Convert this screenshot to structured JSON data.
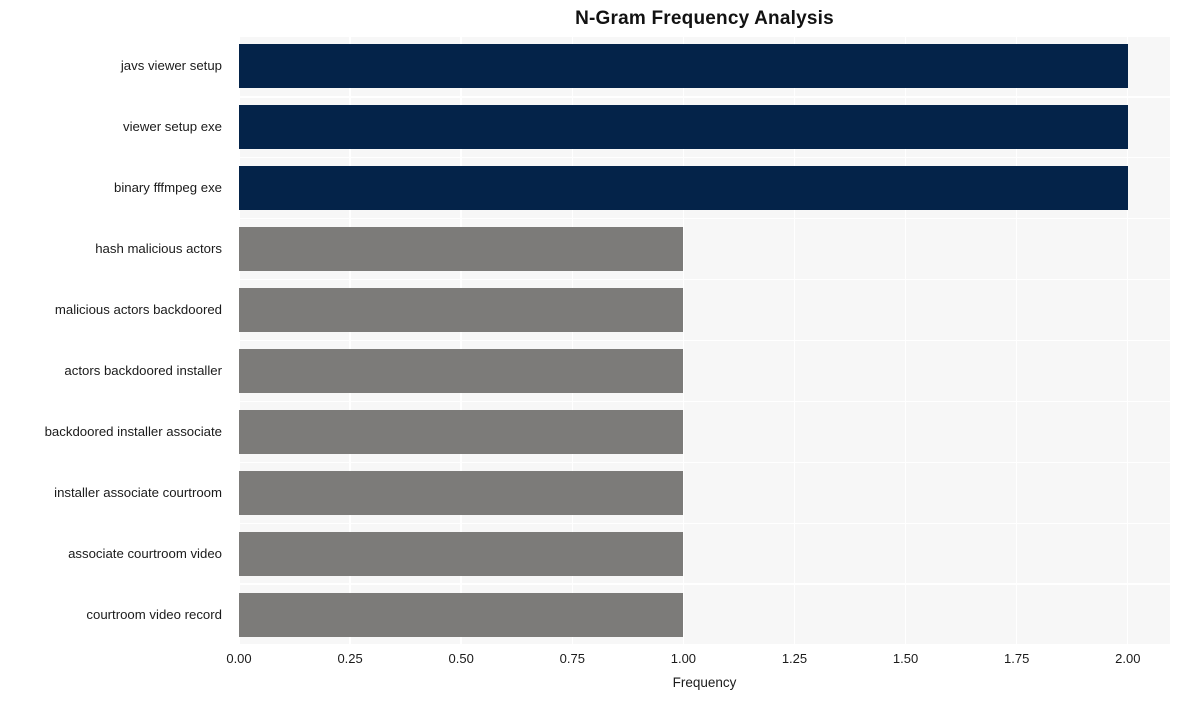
{
  "chart_data": {
    "type": "bar",
    "orientation": "horizontal",
    "title": "N-Gram Frequency Analysis",
    "xlabel": "Frequency",
    "ylabel": "",
    "categories": [
      "javs viewer setup",
      "viewer setup exe",
      "binary fffmpeg exe",
      "hash malicious actors",
      "malicious actors backdoored",
      "actors backdoored installer",
      "backdoored installer associate",
      "installer associate courtroom",
      "associate courtroom video",
      "courtroom video record"
    ],
    "values": [
      2,
      2,
      2,
      1,
      1,
      1,
      1,
      1,
      1,
      1
    ],
    "bar_colors": [
      "#042349",
      "#042349",
      "#042349",
      "#7c7b79",
      "#7c7b79",
      "#7c7b79",
      "#7c7b79",
      "#7c7b79",
      "#7c7b79",
      "#7c7b79"
    ],
    "xlim": [
      0.0,
      2.095
    ],
    "xticks": [
      0.0,
      0.25,
      0.5,
      0.75,
      1.0,
      1.25,
      1.5,
      1.75,
      2.0
    ],
    "xtick_labels": [
      "0.00",
      "0.25",
      "0.50",
      "0.75",
      "1.00",
      "1.25",
      "1.50",
      "1.75",
      "2.00"
    ],
    "grid": true,
    "grid_color": "#ffffff",
    "plot_background": "#f7f7f7",
    "figure_background": "#ffffff",
    "legend": null,
    "legend_position": "none",
    "accent_color": "#042349",
    "secondary_color": "#7c7b79"
  }
}
